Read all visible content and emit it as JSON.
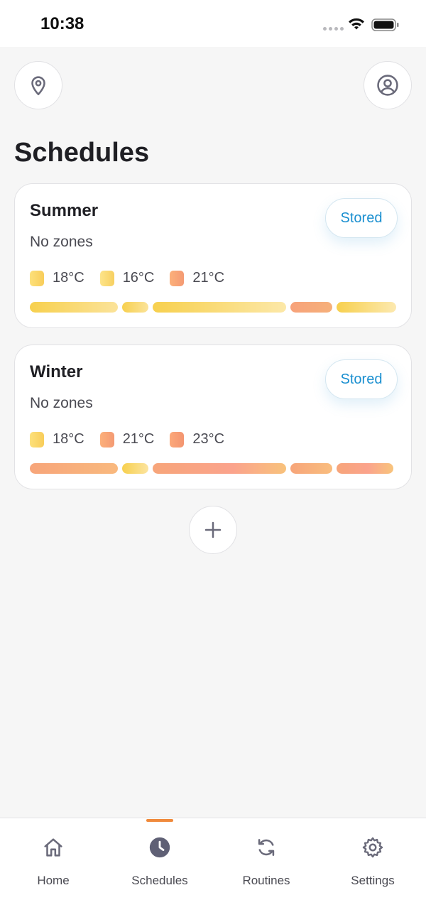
{
  "status_bar": {
    "time": "10:38"
  },
  "header": {
    "location_button_icon": "map-pin-icon",
    "profile_button_icon": "user-circle-icon"
  },
  "page": {
    "title": "Schedules"
  },
  "schedules": [
    {
      "name": "Summer",
      "zones": "No zones",
      "stored_label": "Stored",
      "temps": [
        {
          "label": "18°C",
          "color_from": "#fde07a",
          "color_to": "#f8cd5a"
        },
        {
          "label": "16°C",
          "color_from": "#fde48a",
          "color_to": "#f7d060"
        },
        {
          "label": "21°C",
          "color_from": "#fcb07a",
          "color_to": "#f49a73"
        }
      ]
    },
    {
      "name": "Winter",
      "zones": "No zones",
      "stored_label": "Stored",
      "temps": [
        {
          "label": "18°C",
          "color_from": "#fde07a",
          "color_to": "#f8cd5a"
        },
        {
          "label": "21°C",
          "color_from": "#fcb07a",
          "color_to": "#f49a73"
        },
        {
          "label": "23°C",
          "color_from": "#fca97a",
          "color_to": "#f39470"
        }
      ]
    }
  ],
  "add_button_icon": "plus-icon",
  "tabs": [
    {
      "label": "Home",
      "icon": "home-icon",
      "active": false
    },
    {
      "label": "Schedules",
      "icon": "clock-icon",
      "active": true
    },
    {
      "label": "Routines",
      "icon": "refresh-icon",
      "active": false
    },
    {
      "label": "Settings",
      "icon": "gear-icon",
      "active": false
    }
  ],
  "colors": {
    "accent": "#f08a3c",
    "link_blue": "#1a8fd0",
    "icon_gray": "#6a6a7a"
  }
}
